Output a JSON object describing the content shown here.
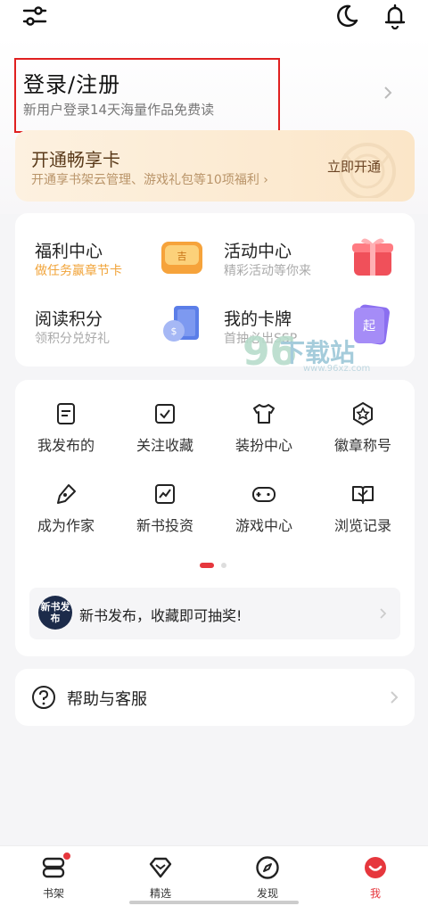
{
  "topbar": {
    "icons": [
      "settings-sliders-icon",
      "moon-icon",
      "bell-icon"
    ]
  },
  "login": {
    "title": "登录/注册",
    "subtitle": "新用户登录14天海量作品免费读"
  },
  "vip": {
    "title": "开通畅享卡",
    "subtitle": "开通享书架云管理、游戏礼包等10项福利 ›",
    "button": "立即开通"
  },
  "features": [
    {
      "title": "福利中心",
      "subtitle": "做任务赢章节卡",
      "icon": "coupon-icon"
    },
    {
      "title": "活动中心",
      "subtitle": "精彩活动等你来",
      "icon": "gift-box-icon"
    },
    {
      "title": "阅读积分",
      "subtitle": "领积分兑好礼",
      "icon": "points-book-icon"
    },
    {
      "title": "我的卡牌",
      "subtitle": "首抽必出SSP",
      "icon": "card-icon"
    }
  ],
  "grid": [
    {
      "label": "我发布的",
      "icon": "document-icon"
    },
    {
      "label": "关注收藏",
      "icon": "bookmark-check-icon"
    },
    {
      "label": "装扮中心",
      "icon": "tshirt-icon"
    },
    {
      "label": "徽章称号",
      "icon": "badge-star-icon"
    },
    {
      "label": "成为作家",
      "icon": "pen-icon"
    },
    {
      "label": "新书投资",
      "icon": "trend-chart-icon"
    },
    {
      "label": "游戏中心",
      "icon": "gamepad-icon"
    },
    {
      "label": "浏览记录",
      "icon": "history-book-icon"
    }
  ],
  "promo": {
    "logo_text": "新书发布",
    "text": "新书发布，收藏即可抽奖!"
  },
  "help": {
    "label": "帮助与客服"
  },
  "watermark": {
    "brand_number": "96",
    "brand_text": "下载站",
    "url": "www.96xz.com"
  },
  "nav": [
    {
      "label": "书架",
      "icon": "bookshelf-icon",
      "badge": true,
      "active": false
    },
    {
      "label": "精选",
      "icon": "diamond-icon",
      "badge": false,
      "active": false
    },
    {
      "label": "发现",
      "icon": "compass-icon",
      "badge": false,
      "active": false
    },
    {
      "label": "我",
      "icon": "profile-face-icon",
      "badge": false,
      "active": true
    }
  ],
  "colors": {
    "accent": "#e6373d",
    "vip_text": "#5a3a1a",
    "orange": "#f1a43a"
  }
}
